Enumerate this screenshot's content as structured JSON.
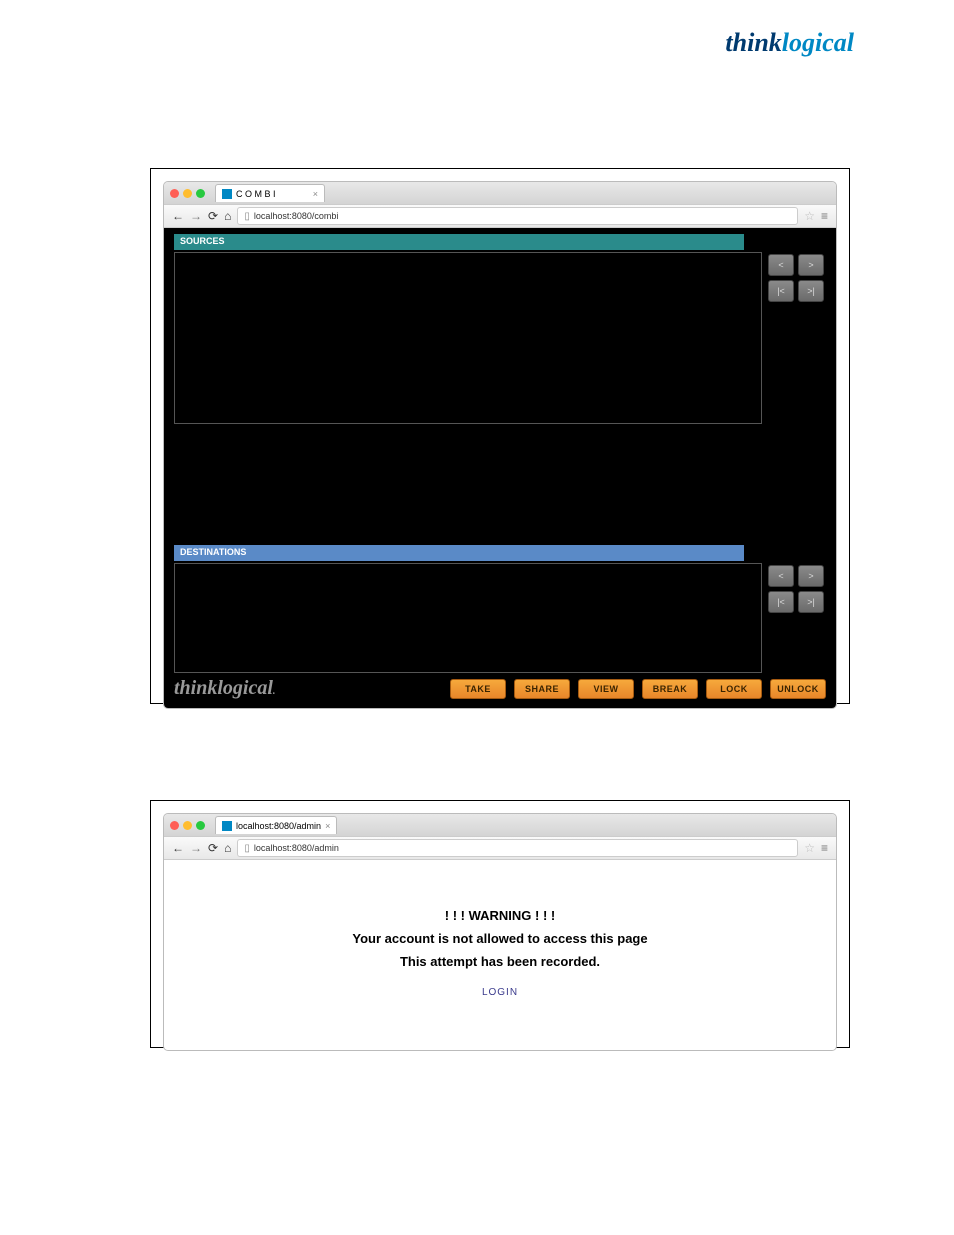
{
  "header": {
    "part1": "think",
    "part2": "logical"
  },
  "fig1": {
    "tab_title": "C O M B I",
    "url": "localhost:8080/combi",
    "sources_label": "SOURCES",
    "destinations_label": "DESTINATIONS",
    "nav_pad": {
      "prev": "<",
      "next": ">",
      "first": "|<",
      "last": ">|"
    },
    "footer_logo": "thinklogical",
    "buttons": {
      "take": "TAKE",
      "share": "SHARE",
      "view": "VIEW",
      "break": "BREAK",
      "lock": "LOCK",
      "unlock": "UNLOCK"
    }
  },
  "fig2": {
    "tab_title": "localhost:8080/admin",
    "url": "localhost:8080/admin",
    "warning_title": "! ! ! WARNING ! ! !",
    "warning_line1": "Your account is not allowed to access this page",
    "warning_line2": "This attempt has been recorded.",
    "login_link": "LOGIN"
  }
}
